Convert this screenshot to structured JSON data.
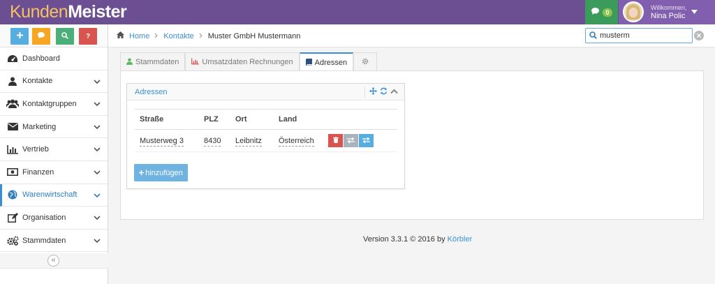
{
  "brand": {
    "part1": "Kunden",
    "part2": "Meister"
  },
  "header": {
    "chat_count": "0",
    "user_greeting": "Willkommen,",
    "user_name": "Nina Polic"
  },
  "quick_actions": [
    {
      "icon": "plus-icon"
    },
    {
      "icon": "comment-icon"
    },
    {
      "icon": "search-icon"
    },
    {
      "label": "?"
    }
  ],
  "sidebar": {
    "items": [
      {
        "label": "Dashboard",
        "icon": "dashboard-icon",
        "has_chevron": false
      },
      {
        "label": "Kontakte",
        "icon": "user-icon",
        "has_chevron": true
      },
      {
        "label": "Kontaktgruppen",
        "icon": "users-icon",
        "has_chevron": true
      },
      {
        "label": "Marketing",
        "icon": "envelope-icon",
        "has_chevron": true
      },
      {
        "label": "Vertrieb",
        "icon": "bar-chart-icon",
        "has_chevron": true
      },
      {
        "label": "Finanzen",
        "icon": "money-icon",
        "has_chevron": true
      },
      {
        "label": "Warenwirtschaft",
        "icon": "globe-icon",
        "has_chevron": true,
        "active": true
      },
      {
        "label": "Organisation",
        "icon": "edit-icon",
        "has_chevron": true
      },
      {
        "label": "Stammdaten",
        "icon": "cogs-icon",
        "has_chevron": true
      }
    ],
    "collapse_symbol": "«"
  },
  "breadcrumb": {
    "home": "Home",
    "contacts": "Kontakte",
    "current": "Muster GmbH Mustermann"
  },
  "search": {
    "value": "musterm"
  },
  "tabs": [
    {
      "label": "Stammdaten",
      "icon": "user-icon"
    },
    {
      "label": "Umsatzdaten Rechnungen",
      "icon": "bar-chart-icon"
    },
    {
      "label": "Adressen",
      "icon": "book-icon",
      "active": true
    },
    {
      "label": "",
      "icon": "gear-icon"
    }
  ],
  "panel": {
    "title": "Adressen",
    "columns": [
      "Straße",
      "PLZ",
      "Ort",
      "Land"
    ],
    "rows": [
      {
        "strasse": "Musterweg 3",
        "plz": "8430",
        "ort": "Leibnitz",
        "land": "Österreich"
      }
    ],
    "add_label": "hinzufügen"
  },
  "footer": {
    "text": "Version 3.3.1 © 2016 by",
    "link": "Körbler"
  },
  "colors": {
    "topbar": "#6c4f93",
    "accent": "#3a8fd1",
    "danger": "#d9534f",
    "success": "#3a9b5b"
  }
}
